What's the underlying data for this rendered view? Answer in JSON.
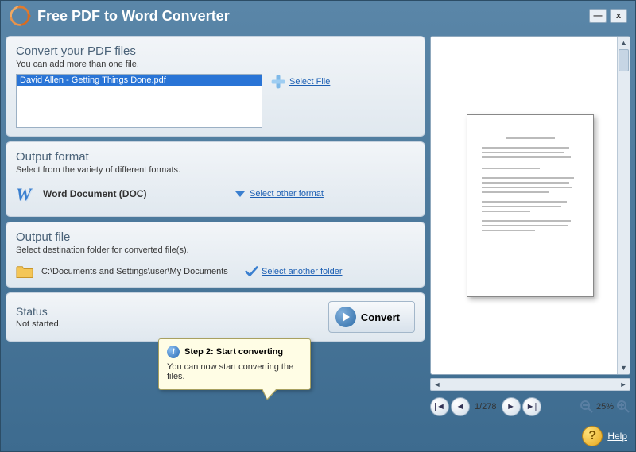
{
  "window": {
    "title": "Free PDF to Word Converter"
  },
  "sections": {
    "convert": {
      "title": "Convert your PDF files",
      "subtitle": "You can add more than one file.",
      "files": [
        "David Allen - Getting Things Done.pdf"
      ],
      "select_file_label": "Select File"
    },
    "format": {
      "title": "Output format",
      "subtitle": "Select from the variety of different formats.",
      "current": "Word Document (DOC)",
      "other_label": "Select other format"
    },
    "output": {
      "title": "Output file",
      "subtitle": "Select destination folder for converted file(s).",
      "path": "C:\\Documents and Settings\\user\\My Documents",
      "other_label": "Select another folder"
    },
    "status": {
      "title": "Status",
      "value": "Not started.",
      "convert_label": "Convert"
    }
  },
  "tooltip": {
    "title": "Step 2: Start converting",
    "body": "You can now start converting the files."
  },
  "preview": {
    "page_current": 1,
    "page_total": 278,
    "page_display": "1/278",
    "zoom": "25%"
  },
  "help": {
    "label": "Help"
  }
}
